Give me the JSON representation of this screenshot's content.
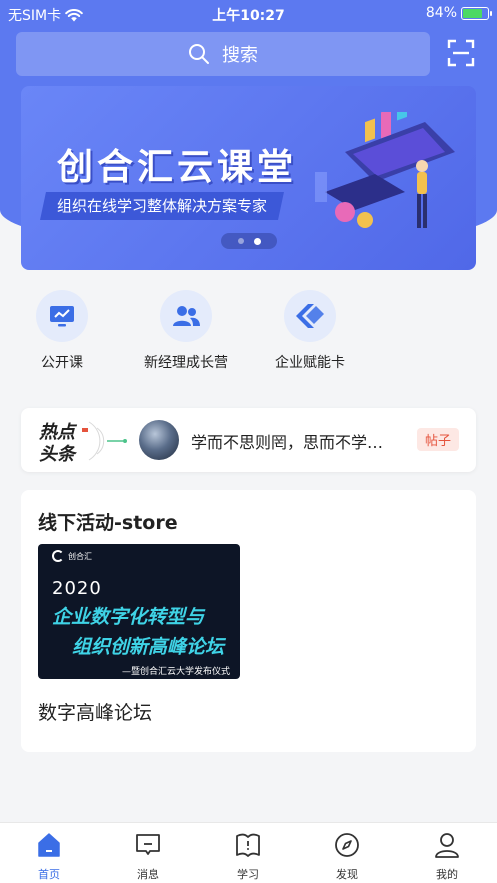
{
  "status_bar": {
    "carrier": "无SIM卡",
    "time": "上午10:27",
    "battery": "84%",
    "battery_level": 0.84
  },
  "search": {
    "placeholder": "搜索"
  },
  "banner": {
    "title": "创合汇云课堂",
    "subtitle": "组织在线学习整体解决方案专家",
    "page_count": 2,
    "active_page": 2
  },
  "quick_links": [
    {
      "label": "公开课",
      "icon": "presentation-icon"
    },
    {
      "label": "新经理成长营",
      "icon": "people-icon"
    },
    {
      "label": "企业赋能卡",
      "icon": "card-arrow-icon"
    }
  ],
  "hot_news": {
    "logo_line1": "热点",
    "logo_line2": "头条",
    "text": "学而不思则罔，思而不学…",
    "tag": "帖子"
  },
  "activity": {
    "section_title": "线下活动-store",
    "image": {
      "brand": "创合汇",
      "year": "2020",
      "line1": "企业数字化转型与",
      "line2": "组织创新高峰论坛",
      "caption": "—暨创合汇云大学发布仪式"
    },
    "name": "数字高峰论坛"
  },
  "tabbar": [
    {
      "label": "首页",
      "icon": "home-icon",
      "active": true
    },
    {
      "label": "消息",
      "icon": "message-icon",
      "active": false
    },
    {
      "label": "学习",
      "icon": "book-icon",
      "active": false
    },
    {
      "label": "发现",
      "icon": "compass-icon",
      "active": false
    },
    {
      "label": "我的",
      "icon": "profile-icon",
      "active": false
    }
  ],
  "colors": {
    "primary": "#5c79f0",
    "active_tab": "#3b6ee6",
    "tag_red": "#e5533d",
    "img_cyan": "#3fd3e6"
  }
}
